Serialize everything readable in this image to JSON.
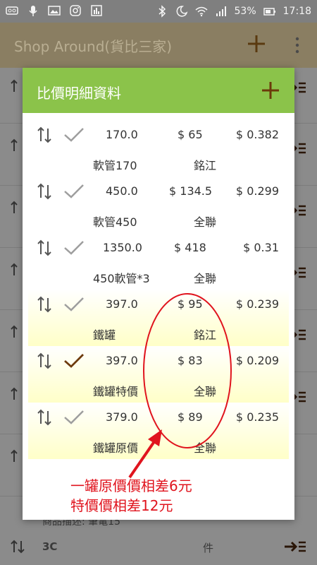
{
  "status_bar": {
    "battery": "53%",
    "time": "17:18"
  },
  "toolbar": {
    "title": "Shop Around(貨比三家)"
  },
  "background": {
    "item_desc": "商品描述: 筆電15",
    "row_name": "3C",
    "row_unit": "件"
  },
  "dialog": {
    "title": "比價明細資料",
    "rows": [
      {
        "amount": "170.0",
        "price": "$ 65",
        "unit_price": "$ 0.382",
        "name": "軟管170",
        "store": "銘江"
      },
      {
        "amount": "450.0",
        "price": "$ 134.5",
        "unit_price": "$ 0.299",
        "name": "軟管450",
        "store": "全聯"
      },
      {
        "amount": "1350.0",
        "price": "$ 418",
        "unit_price": "$ 0.31",
        "name": "450軟管*3",
        "store": "全聯"
      },
      {
        "amount": "397.0",
        "price": "$ 95",
        "unit_price": "$ 0.239",
        "name": "鐵罐",
        "store": "銘江"
      },
      {
        "amount": "397.0",
        "price": "$ 83",
        "unit_price": "$ 0.209",
        "name": "鐵罐特價",
        "store": "全聯"
      },
      {
        "amount": "379.0",
        "price": "$ 89",
        "unit_price": "$ 0.235",
        "name": "鐵罐原價",
        "store": "全聯"
      }
    ]
  },
  "annotation": {
    "line1": "一罐原價價相差6元",
    "line2": "特價價相差12元"
  },
  "colors": {
    "header_green": "#8bc34a",
    "highlight_yellow": "#ffffc8",
    "annotation_red": "#e0141e",
    "check_gray": "#9e9e9e",
    "check_selected": "#6d3a0c"
  }
}
